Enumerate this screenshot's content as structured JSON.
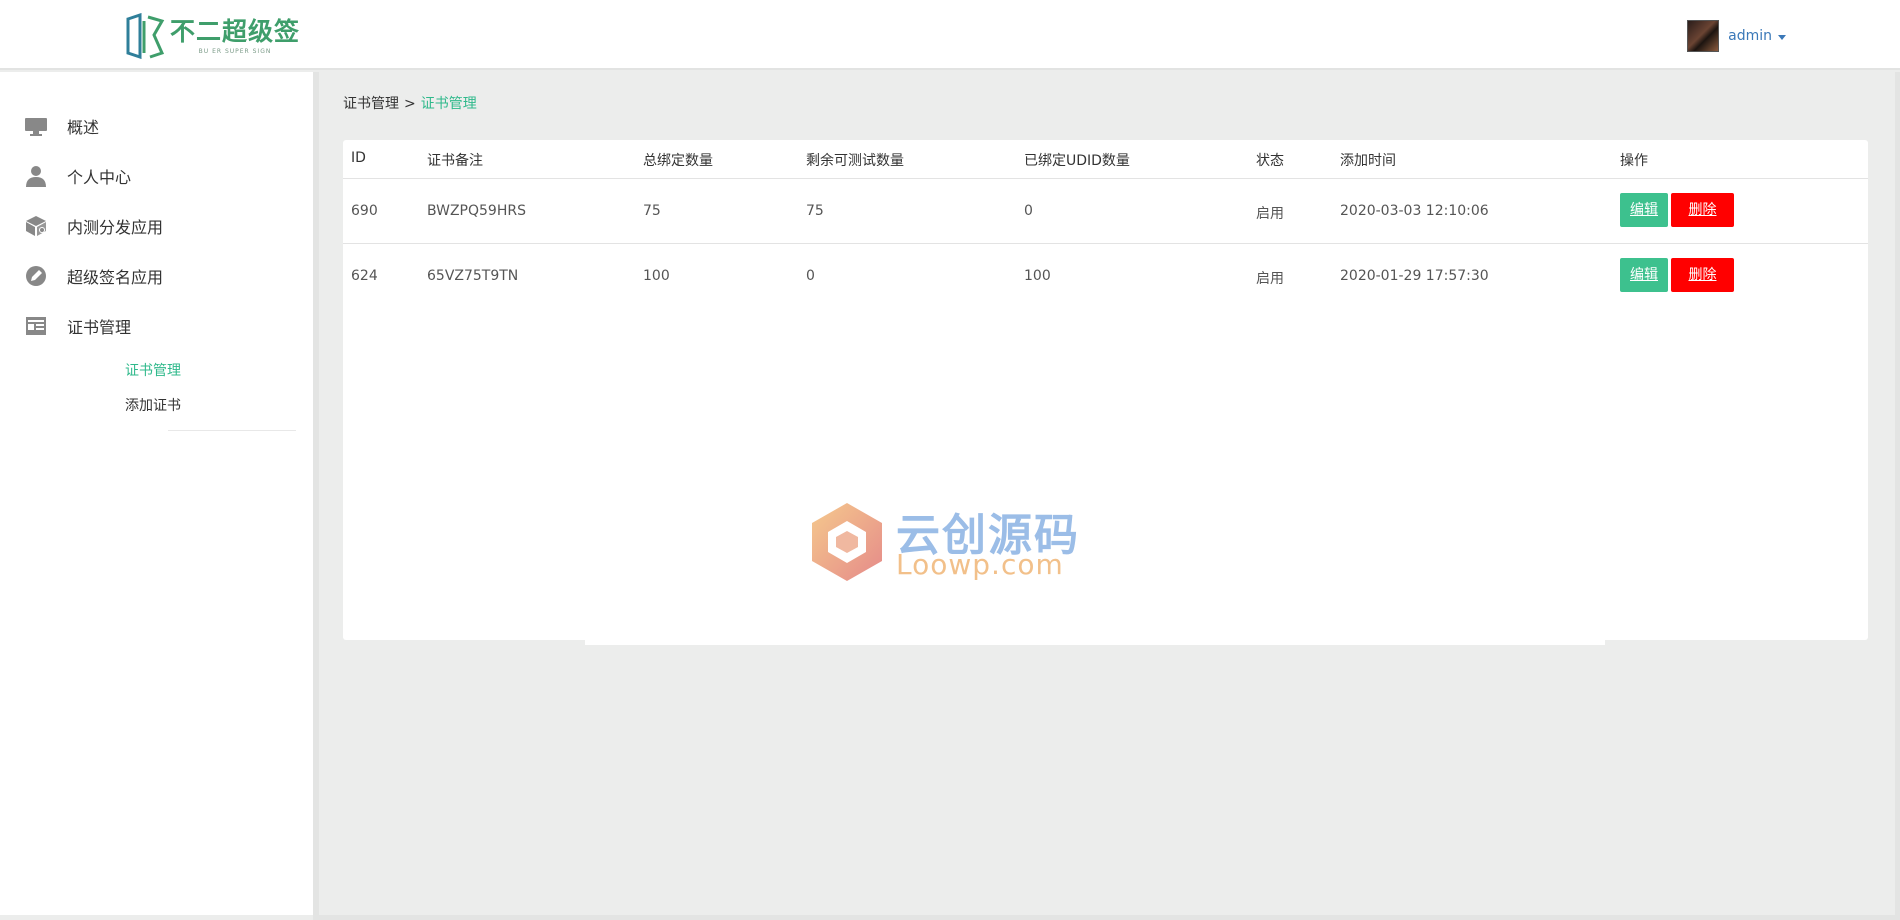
{
  "header": {
    "logo_title": "不二超级签",
    "logo_sub": "BU ER SUPER SIGN",
    "username": "admin"
  },
  "sidebar": {
    "items": [
      {
        "label": "概述",
        "icon": "monitor-icon"
      },
      {
        "label": "个人中心",
        "icon": "user-icon"
      },
      {
        "label": "内测分发应用",
        "icon": "package-icon"
      },
      {
        "label": "超级签名应用",
        "icon": "pen-icon"
      },
      {
        "label": "证书管理",
        "icon": "certificate-icon"
      }
    ],
    "sub_items": [
      {
        "label": "证书管理",
        "active": true
      },
      {
        "label": "添加证书",
        "active": false
      }
    ]
  },
  "breadcrumb": {
    "parent": "证书管理",
    "separator": ">",
    "current": "证书管理"
  },
  "table": {
    "headers": {
      "id": "ID",
      "note": "证书备注",
      "total": "总绑定数量",
      "remain": "剩余可测试数量",
      "bound": "已绑定UDID数量",
      "status": "状态",
      "time": "添加时间",
      "op": "操作"
    },
    "rows": [
      {
        "id": "690",
        "note": "BWZPQ59HRS",
        "total": "75",
        "remain": "75",
        "bound": "0",
        "status": "启用",
        "time": "2020-03-03 12:10:06"
      },
      {
        "id": "624",
        "note": "65VZ75T9TN",
        "total": "100",
        "remain": "0",
        "bound": "100",
        "status": "启用",
        "time": "2020-01-29 17:57:30"
      }
    ],
    "edit_label": "编辑",
    "delete_label": "删除"
  },
  "watermark": {
    "title": "云创源码",
    "url": "Loowp.com"
  },
  "colors": {
    "accent": "#2fb98b",
    "edit_button": "#3dc18e",
    "delete_button": "#ff0000",
    "logo": "#3f9e6b"
  }
}
